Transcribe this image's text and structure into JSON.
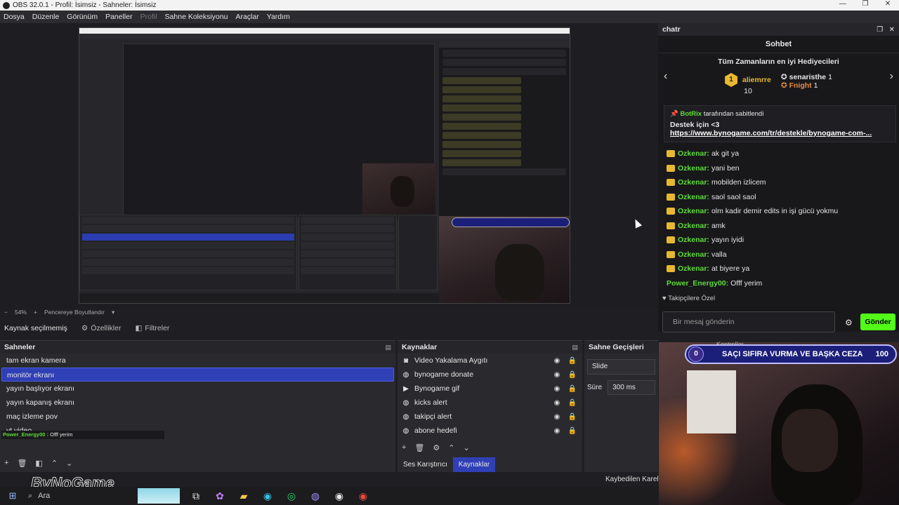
{
  "window": {
    "title": "OBS 32.0.1 - Profil: İsimsiz - Sahneler: İsimsiz"
  },
  "menu": [
    "Dosya",
    "Düzenle",
    "Görünüm",
    "Paneller",
    "Profil",
    "Sahne Koleksiyonu",
    "Araçlar",
    "Yardım"
  ],
  "preview": {
    "zoom": "54%",
    "fit": "Pencereye Boyutlandır"
  },
  "source_bar": {
    "status": "Kaynak seçilmemiş",
    "properties": "Özellikler",
    "filters": "Filtreler"
  },
  "scenes": {
    "title": "Sahneler",
    "items": [
      "tam ekran kamera",
      "monitör ekranı",
      "yayın başlıyor ekranı",
      "yayın kapanış ekranı",
      "maç izleme pov",
      "yt video"
    ]
  },
  "sources": {
    "title": "Kaynaklar",
    "items": [
      {
        "icon": "camera-icon",
        "glyph": "◙",
        "name": "Video Yakalama Aygıtı"
      },
      {
        "icon": "browser-icon",
        "glyph": "◍",
        "name": "bynogame donate"
      },
      {
        "icon": "play-icon",
        "glyph": "▶",
        "name": "Bynogame gif"
      },
      {
        "icon": "browser-icon",
        "glyph": "◍",
        "name": "kicks alert"
      },
      {
        "icon": "browser-icon",
        "glyph": "◍",
        "name": "takipçi alert"
      },
      {
        "icon": "browser-icon",
        "glyph": "◍",
        "name": "abone hedefi"
      }
    ],
    "tab_mixer": "Ses Karıştırıcı",
    "tab_sources": "Kaynaklar"
  },
  "transitions": {
    "title": "Sahne Geçişleri",
    "type": "Slide",
    "duration_label": "Süre",
    "duration": "300 ms"
  },
  "controls_label": "Kontroller",
  "dropped_frames": "Kaybedilen Kareler",
  "chat": {
    "dock_title": "chatr",
    "header": "Sohbet",
    "gifters_title": "Tüm Zamanların en iyi Hediyecileri",
    "top1": {
      "name": "aliemrre",
      "count": "10"
    },
    "top2": {
      "name": "senaristhe",
      "count": "1"
    },
    "top3": {
      "name": "Fnight",
      "count": "1"
    },
    "pinned_by": "BotRix",
    "pinned_suffix": "tarafından sabitlendi",
    "pinned_text": "Destek için <3",
    "pinned_link": "https://www.bynogame.com/tr/destekle/bynogame-com-...",
    "messages": [
      {
        "user": "Ozkenar:",
        "text": "ak git ya",
        "crown": true
      },
      {
        "user": "Ozkenar:",
        "text": "yani ben",
        "crown": true
      },
      {
        "user": "Ozkenar:",
        "text": "mobilden izlicem",
        "crown": true
      },
      {
        "user": "Ozkenar:",
        "text": "saol saol saol",
        "crown": true
      },
      {
        "user": "Ozkenar:",
        "text": "olm kadir demir edits in işi gücü yokmu",
        "crown": true
      },
      {
        "user": "Ozkenar:",
        "text": "amk",
        "crown": true
      },
      {
        "user": "Ozkenar:",
        "text": "yayın iyidi",
        "crown": true
      },
      {
        "user": "Ozkenar:",
        "text": "valla",
        "crown": true
      },
      {
        "user": "Ozkenar:",
        "text": "at biyere ya",
        "crown": true
      },
      {
        "user": "Power_Energy00:",
        "text": "Offf yerim",
        "crown": false
      }
    ],
    "followers_only": "Takipçilere Özel",
    "input_placeholder": "Bir mesaj gönderin",
    "send": "Gönder"
  },
  "overlay": {
    "goal_current": "0",
    "goal_text": "SAÇI SIFIRA VURMA VE BAŞKA CEZA",
    "goal_target": "100",
    "last_line_user": "Power_Energy00 :",
    "last_line_text": "Offf yerim",
    "brand": "ByNoGame"
  },
  "taskbar": {
    "search": "Ara"
  },
  "colors": {
    "accent": "#2f3fb5",
    "kick_green": "#53fc18",
    "goal_bar": "#1c1f7a"
  }
}
